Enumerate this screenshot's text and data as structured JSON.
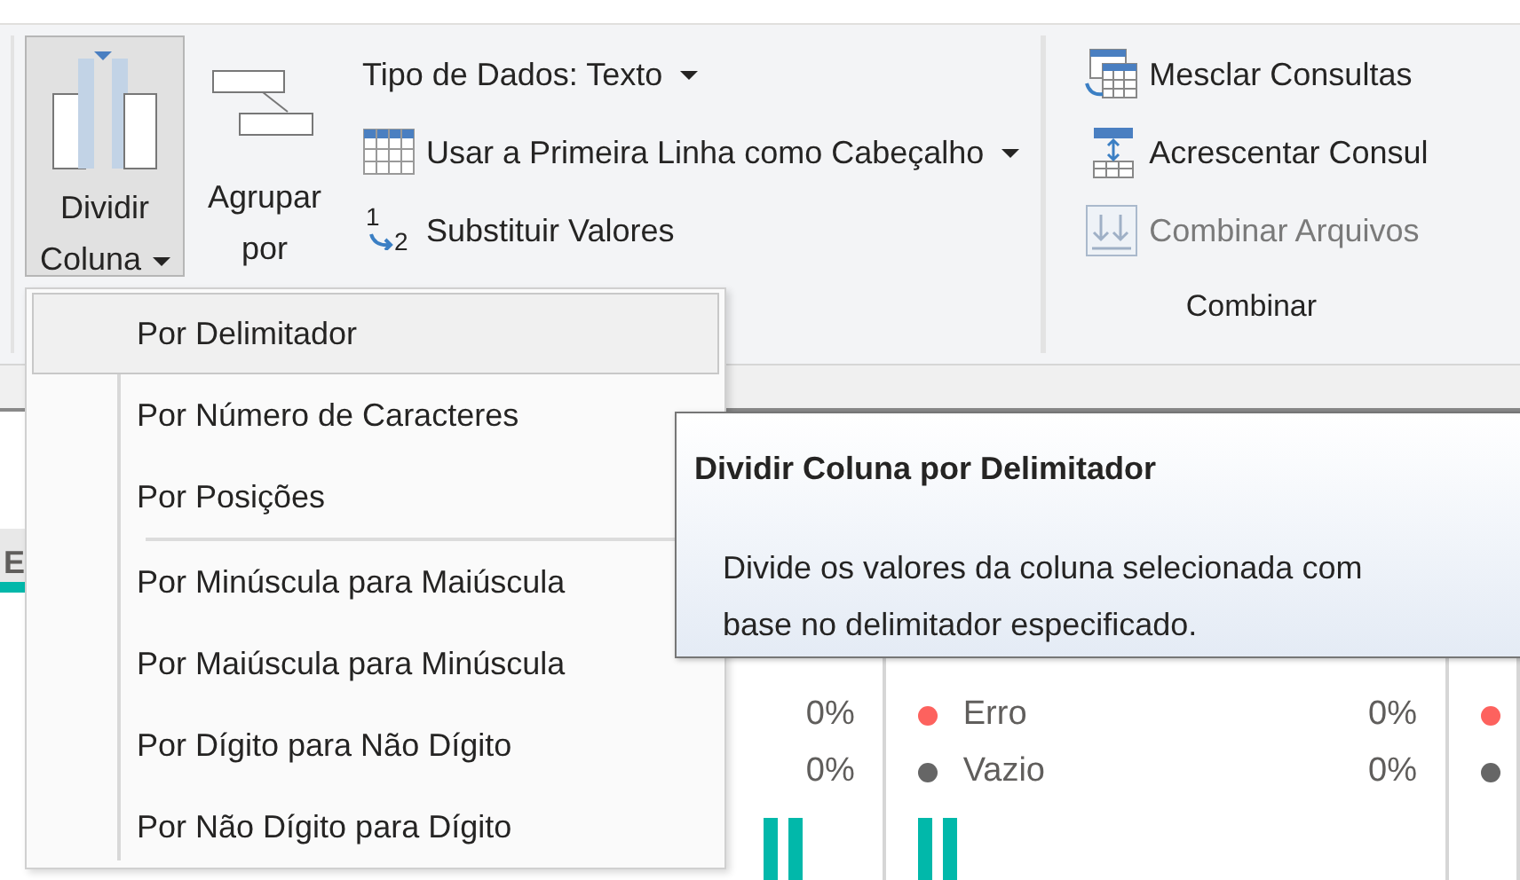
{
  "ribbon": {
    "groups": [
      {
        "items": [
          {
            "kind": "large",
            "lines": [
              "Dividir",
              "Coluna"
            ],
            "dropdown": true,
            "pressed": true
          },
          {
            "kind": "large",
            "lines": [
              "Agrupar",
              "por"
            ],
            "dropdown": false,
            "pressed": false
          },
          {
            "kind": "stack",
            "entries": [
              {
                "label": "Tipo de Dados: Texto",
                "dropdown": true,
                "disabled": false
              },
              {
                "label": "Usar a Primeira Linha como Cabeçalho",
                "dropdown": true,
                "disabled": false
              },
              {
                "label": "Substituir Valores",
                "dropdown": false,
                "disabled": false,
                "digits": [
                  "1",
                  "2"
                ]
              }
            ]
          }
        ]
      },
      {
        "label": "Combinar",
        "items": [
          {
            "kind": "stack",
            "entries": [
              {
                "label": "Mesclar Consultas",
                "dropdown": false,
                "disabled": false
              },
              {
                "label": "Acrescentar Consul",
                "dropdown": false,
                "disabled": false
              },
              {
                "label": "Combinar Arquivos",
                "dropdown": false,
                "disabled": true
              }
            ]
          }
        ]
      }
    ]
  },
  "profile": {
    "header": "E",
    "columns": [
      {
        "rows": [
          {
            "value": "0%"
          },
          {
            "value": "0%"
          }
        ]
      },
      {
        "rows": [
          {
            "label": "Erro",
            "value": "0%",
            "color": "#fd625e"
          },
          {
            "label": "Vazio",
            "value": "0%",
            "color": "#666666"
          }
        ]
      },
      {
        "rows": [
          {
            "color": "#fd625e"
          },
          {
            "color": "#666666"
          }
        ]
      }
    ]
  },
  "menu": {
    "items": [
      {
        "label": "Por Delimitador",
        "selected": true,
        "separator_before": false
      },
      {
        "label": "Por Número de Caracteres",
        "selected": false,
        "separator_before": false
      },
      {
        "label": "Por Posições",
        "selected": false,
        "separator_before": false
      },
      {
        "label": "Por Minúscula para Maiúscula",
        "selected": false,
        "separator_before": true
      },
      {
        "label": "Por Maiúscula para Minúscula",
        "selected": false,
        "separator_before": false
      },
      {
        "label": "Por Dígito para Não Dígito",
        "selected": false,
        "separator_before": false
      },
      {
        "label": "Por Não Dígito para Dígito",
        "selected": false,
        "separator_before": false
      }
    ]
  },
  "tooltip": {
    "title": "Dividir Coluna por Delimitador",
    "lines": [
      "Divide os valores da coluna selecionada com",
      "base no delimitador especificado."
    ]
  }
}
